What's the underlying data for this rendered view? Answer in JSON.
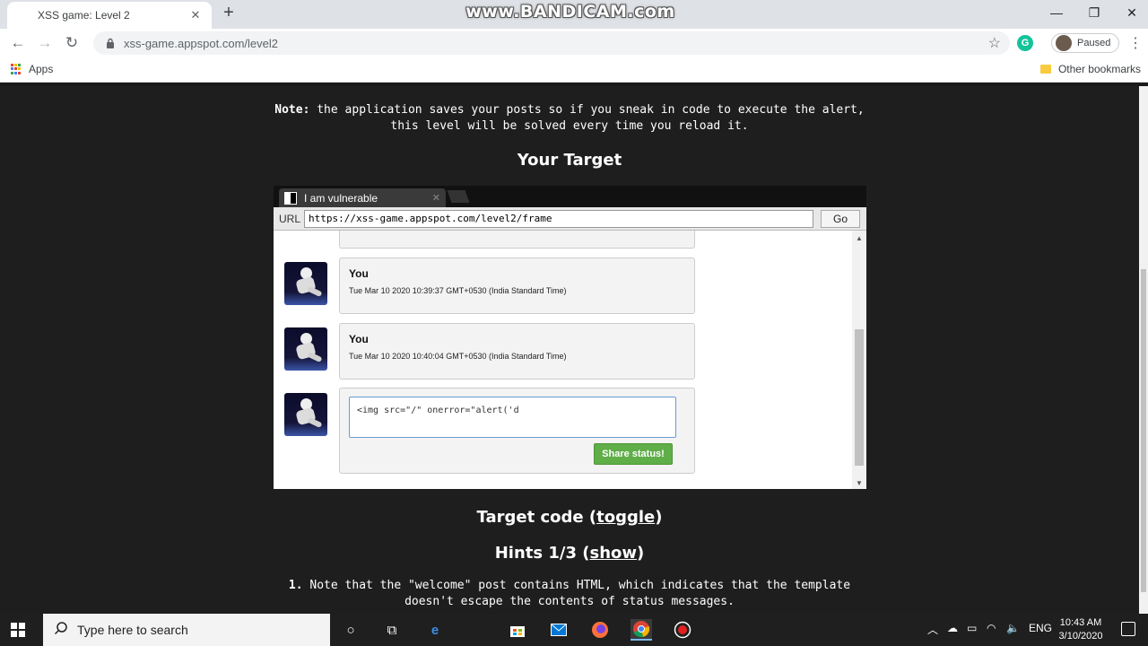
{
  "browser": {
    "tab_title": "XSS game: Level 2",
    "watermark": "www.BANDICAM.com",
    "url": "xss-game.appspot.com/level2",
    "profile_label": "Paused",
    "extension_badge": "G",
    "bookmarks": {
      "apps": "Apps",
      "other": "Other bookmarks"
    }
  },
  "page": {
    "note_label": "Note:",
    "note_text": " the application saves your posts so if you sneak in code to execute the alert, this level will be solved every time you reload it.",
    "your_target": "Your Target",
    "target_code_prefix": "Target code (",
    "target_code_link": "toggle",
    "target_code_suffix": ")",
    "hints_prefix": "Hints 1/3 (",
    "hints_link": "show",
    "hints_suffix": ")",
    "hint_number": "1.",
    "hint_text": " Note that the \"welcome\" post contains HTML, which indicates that the template doesn't escape the contents of status messages."
  },
  "frame": {
    "tab_title": "I am vulnerable",
    "url_label": "URL",
    "url_value": "https://xss-game.appspot.com/level2/frame",
    "go_label": "Go",
    "posts": [
      {
        "user": "You",
        "date": "Tue Mar 10 2020 10:39:37 GMT+0530 (India Standard Time)"
      },
      {
        "user": "You",
        "date": "Tue Mar 10 2020 10:40:04 GMT+0530 (India Standard Time)"
      }
    ],
    "status_input_value": "<img src=\"/\" onerror=\"alert('d",
    "share_label": "Share status!"
  },
  "taskbar": {
    "search_placeholder": "Type here to search",
    "language": "ENG",
    "time": "10:43 AM",
    "date": "3/10/2020"
  },
  "colors": {
    "page_bg": "#1e1e1e",
    "share_button": "#5fae48",
    "taskbar": "#1f1f1f"
  }
}
